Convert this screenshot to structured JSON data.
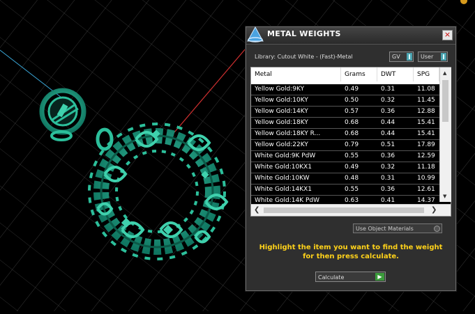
{
  "panel": {
    "title": "METAL WEIGHTS",
    "close_label": "×",
    "library_label": "Library: Cutout White - (Fast)-Metal",
    "toggle_gv": "GV",
    "toggle_user": "User",
    "use_object_materials": "Use Object Materials",
    "instruction": "Highlight the item you want to find the weight for then press calculate.",
    "calculate_label": "Calculate",
    "calculate_arrow": "▶"
  },
  "table": {
    "columns": [
      "Metal",
      "Grams",
      "DWT",
      "SPG"
    ],
    "rows": [
      [
        "Yellow Gold:9KY",
        "0.49",
        "0.31",
        "11.08"
      ],
      [
        "Yellow Gold:10KY",
        "0.50",
        "0.32",
        "11.45"
      ],
      [
        "Yellow Gold:14KY",
        "0.57",
        "0.36",
        "12.88"
      ],
      [
        "Yellow Gold:18KY",
        "0.68",
        "0.44",
        "15.41"
      ],
      [
        "Yellow Gold:18KY R...",
        "0.68",
        "0.44",
        "15.41"
      ],
      [
        "Yellow Gold:22KY",
        "0.79",
        "0.51",
        "17.89"
      ],
      [
        "White Gold:9K PdW",
        "0.55",
        "0.36",
        "12.59"
      ],
      [
        "White Gold:10KX1",
        "0.49",
        "0.32",
        "11.18"
      ],
      [
        "White Gold:10KW",
        "0.48",
        "0.31",
        "10.99"
      ],
      [
        "White Gold:14KX1",
        "0.55",
        "0.36",
        "12.61"
      ],
      [
        "White Gold:14K PdW",
        "0.63",
        "0.41",
        "14.37"
      ]
    ]
  },
  "scrollbars": {
    "up": "▲",
    "down": "▼",
    "left": "❮",
    "right": "❯"
  },
  "colors": {
    "accent_teal": "#4aa3b0",
    "instruction_yellow": "#ffd21a",
    "pendant_green": "#1fa888"
  }
}
